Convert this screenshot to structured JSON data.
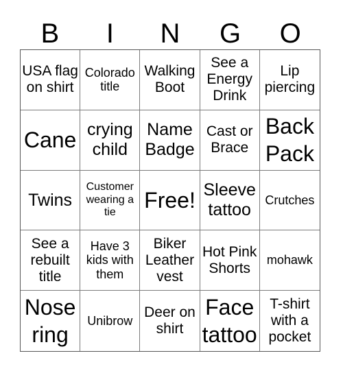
{
  "header": {
    "letters": [
      "B",
      "I",
      "N",
      "G",
      "O"
    ]
  },
  "cells": [
    {
      "text": "USA flag on shirt",
      "size": "md"
    },
    {
      "text": "Colorado title",
      "size": "sm"
    },
    {
      "text": "Walking Boot",
      "size": "md"
    },
    {
      "text": "See a Energy Drink",
      "size": "md"
    },
    {
      "text": "Lip piercing",
      "size": "md"
    },
    {
      "text": "Cane",
      "size": "xl"
    },
    {
      "text": "crying child",
      "size": "lg"
    },
    {
      "text": "Name Badge",
      "size": "lg"
    },
    {
      "text": "Cast or Brace",
      "size": "md"
    },
    {
      "text": "Back Pack",
      "size": "xl"
    },
    {
      "text": "Twins",
      "size": "lg"
    },
    {
      "text": "Customer wearing a tie",
      "size": "xs"
    },
    {
      "text": "Free!",
      "size": "xl"
    },
    {
      "text": "Sleeve tattoo",
      "size": "lg"
    },
    {
      "text": "Crutches",
      "size": "sm"
    },
    {
      "text": "See a rebuilt title",
      "size": "md"
    },
    {
      "text": "Have 3 kids with them",
      "size": "sm"
    },
    {
      "text": "Biker Leather vest",
      "size": "md"
    },
    {
      "text": "Hot Pink Shorts",
      "size": "md"
    },
    {
      "text": "mohawk",
      "size": "sm"
    },
    {
      "text": "Nose ring",
      "size": "xl"
    },
    {
      "text": "Unibrow",
      "size": "sm"
    },
    {
      "text": "Deer on shirt",
      "size": "md"
    },
    {
      "text": "Face tattoo",
      "size": "xl"
    },
    {
      "text": "T-shirt with a pocket",
      "size": "md"
    }
  ]
}
